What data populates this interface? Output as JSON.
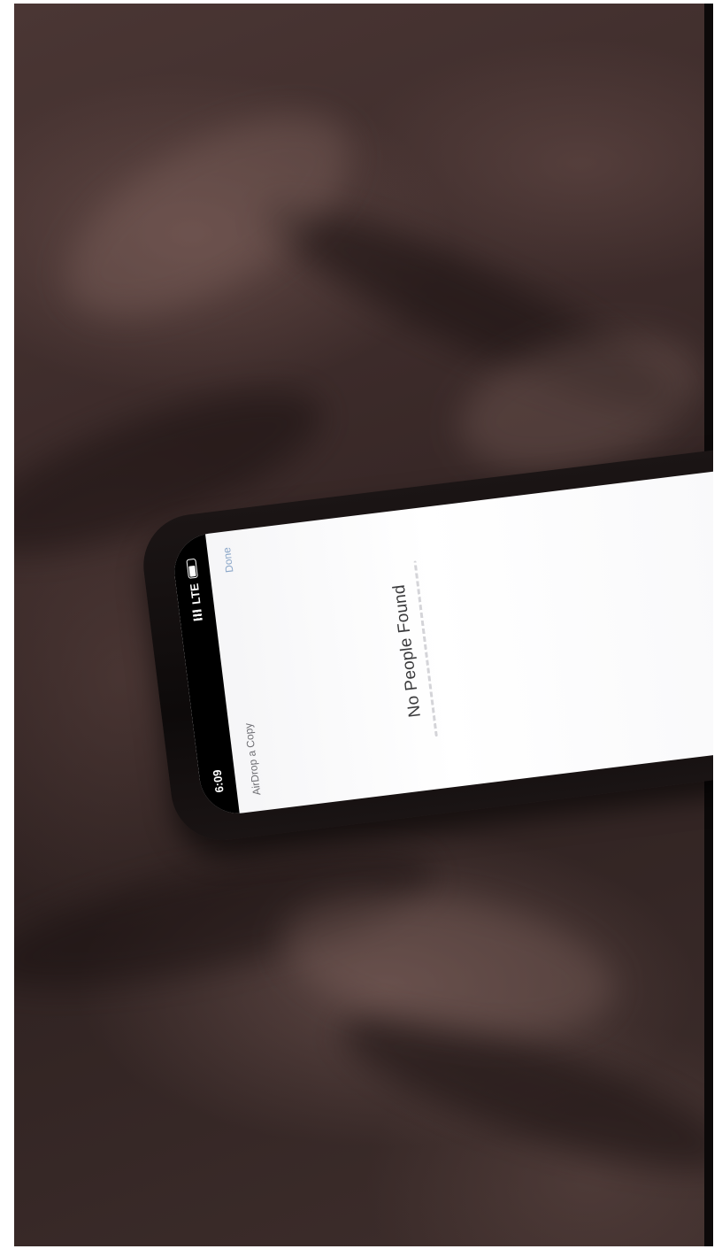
{
  "scene": {
    "description_type": "photo-of-phone",
    "fabric_color": "#3b2a29"
  },
  "phone": {
    "status_bar": {
      "time": "6:09",
      "network": "LTE"
    },
    "nav": {
      "title": "AirDrop a Copy",
      "done_label": "Done"
    },
    "empty_state": {
      "title": "No People Found"
    }
  }
}
